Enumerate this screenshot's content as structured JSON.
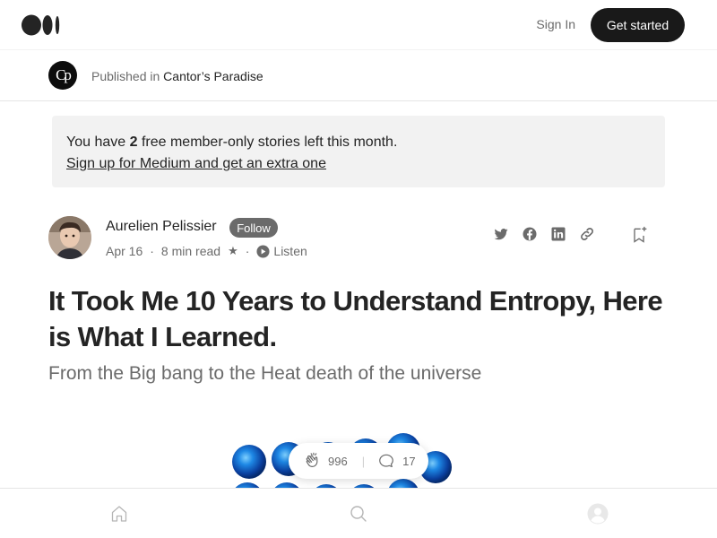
{
  "header": {
    "signin_label": "Sign In",
    "get_started_label": "Get started"
  },
  "publication": {
    "logo_text": "Cp",
    "published_in_label": "Published in",
    "name": "Cantor’s Paradise"
  },
  "banner": {
    "prefix": "You have",
    "count": "2",
    "suffix": "free member-only stories left this month.",
    "link_label": "Sign up for Medium and get an extra one"
  },
  "author": {
    "name": "Aurelien Pelissier",
    "follow_label": "Follow",
    "date": "Apr 16",
    "read_time": "8 min read",
    "member_star": "★",
    "listen_label": "Listen"
  },
  "share_icons": [
    "twitter-icon",
    "facebook-icon",
    "linkedin-icon",
    "link-icon",
    "bookmark-add-icon"
  ],
  "article": {
    "title": "It Took Me 10 Years to Understand Entropy, Here is What I Learned.",
    "subtitle": "From the Big bang to the Heat death of the universe"
  },
  "engagement": {
    "claps": "996",
    "responses": "17"
  },
  "bottom_nav": [
    "home-icon",
    "search-icon",
    "profile-icon"
  ],
  "colors": {
    "text": "#242424",
    "muted": "#6b6b6b",
    "button_dark": "#191919",
    "banner_bg": "#f2f2f2",
    "sphere_blue": "#1565c0"
  }
}
